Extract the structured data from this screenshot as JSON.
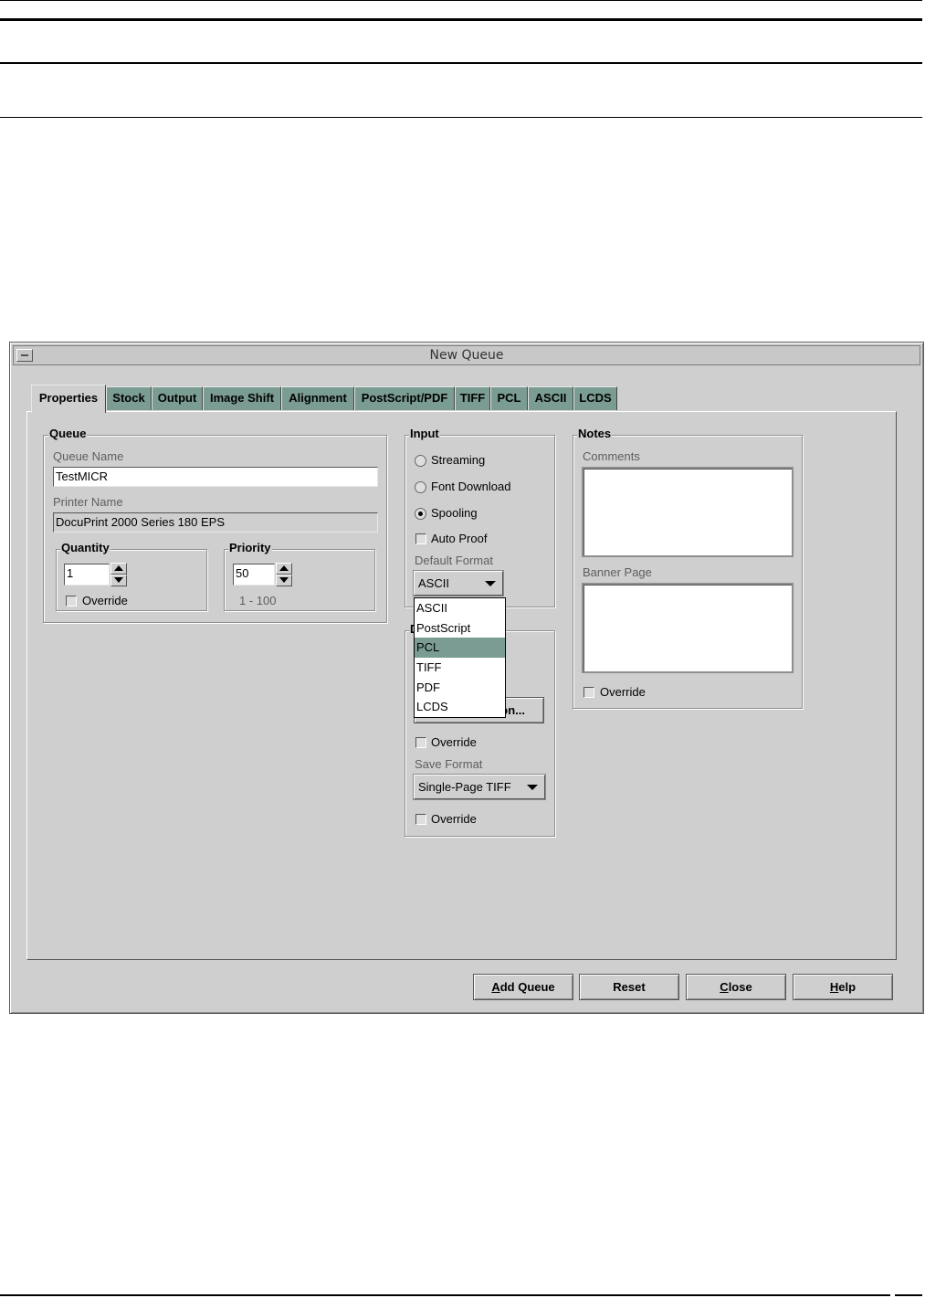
{
  "window": {
    "title": "New Queue"
  },
  "tabs": [
    "Properties",
    "Stock",
    "Output",
    "Image Shift",
    "Alignment",
    "PostScript/PDF",
    "TIFF",
    "PCL",
    "ASCII",
    "LCDS"
  ],
  "queue": {
    "legend": "Queue",
    "queue_name_label": "Queue Name",
    "queue_name_value": "TestMICR",
    "printer_name_label": "Printer Name",
    "printer_name_value": "DocuPrint 2000 Series 180 EPS",
    "quantity": {
      "legend": "Quantity",
      "value": "1",
      "override_label": "Override"
    },
    "priority": {
      "legend": "Priority",
      "value": "50",
      "range": "1 - 100"
    }
  },
  "input": {
    "legend": "Input",
    "streaming_label": "Streaming",
    "font_download_label": "Font Download",
    "spooling_label": "Spooling",
    "selected_mode": "Spooling",
    "auto_proof_label": "Auto Proof",
    "default_format_label": "Default Format",
    "default_format_value": "ASCII"
  },
  "format_dropdown": {
    "options": [
      "ASCII",
      "PostScript",
      "PCL",
      "TIFF",
      "PDF",
      "LCDS"
    ],
    "highlighted": "PCL"
  },
  "save": {
    "legend_visible": "D",
    "button_visible_label": "on...",
    "override1_label": "Override",
    "save_format_label": "Save Format",
    "save_format_value": "Single-Page TIFF",
    "override2_label": "Override"
  },
  "notes": {
    "legend": "Notes",
    "comments_label": "Comments",
    "banner_page_label": "Banner Page",
    "override_label": "Override"
  },
  "buttons": {
    "add_queue": {
      "mnemonic": "A",
      "rest": "dd Queue"
    },
    "reset": "Reset",
    "close": {
      "mnemonic": "C",
      "rest": "lose"
    },
    "help": {
      "mnemonic": "H",
      "rest": "elp"
    }
  },
  "colors": {
    "accent": "#7a9c92",
    "window_bg": "#cfcfcf"
  }
}
